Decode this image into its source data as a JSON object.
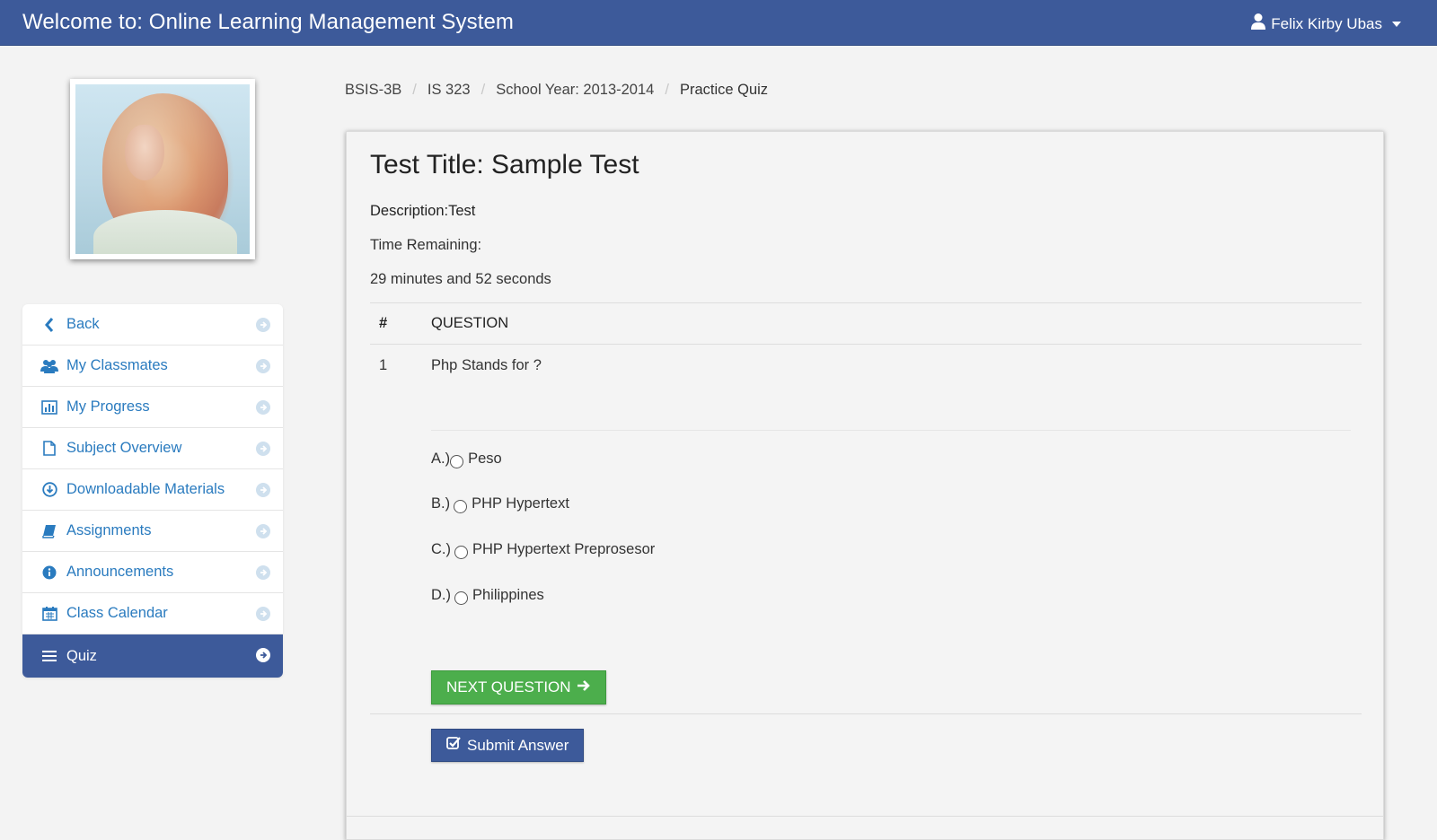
{
  "app": {
    "title": "Welcome to: Online Learning Management System",
    "user_name": "Felix Kirby Ubas",
    "accent_color": "#3d5a9a",
    "success_color": "#4cae4c",
    "link_color": "#2a7bbf"
  },
  "profile": {
    "photo_icon": "profile-photo"
  },
  "sidebar": {
    "items": [
      {
        "label": "Back",
        "icon": "chevron-left-icon",
        "active": false
      },
      {
        "label": "My Classmates",
        "icon": "users-icon",
        "active": false
      },
      {
        "label": "My Progress",
        "icon": "bar-chart-icon",
        "active": false
      },
      {
        "label": "Subject Overview",
        "icon": "file-icon",
        "active": false
      },
      {
        "label": "Downloadable Materials",
        "icon": "download-icon",
        "active": false
      },
      {
        "label": "Assignments",
        "icon": "book-icon",
        "active": false
      },
      {
        "label": "Announcements",
        "icon": "info-icon",
        "active": false
      },
      {
        "label": "Class Calendar",
        "icon": "calendar-icon",
        "active": false
      },
      {
        "label": "Quiz",
        "icon": "list-icon",
        "active": true
      }
    ]
  },
  "breadcrumb": {
    "items": [
      "BSIS-3B",
      "IS 323",
      "School Year: 2013-2014"
    ],
    "current": "Practice Quiz",
    "separator": "/"
  },
  "quiz": {
    "title": "Test Title: Sample Test",
    "description": "Description:Test",
    "time_label": "Time Remaining:",
    "time_value": "29 minutes and 52 seconds",
    "table_headers": {
      "num": "#",
      "question": "QUESTION"
    },
    "question": {
      "num": "1",
      "text": "Php Stands for ?"
    },
    "choices": [
      {
        "letter": "A.)",
        "text": "Peso"
      },
      {
        "letter": "B.)",
        "text": "PHP Hypertext"
      },
      {
        "letter": "C.)",
        "text": "PHP Hypertext Preprosesor"
      },
      {
        "letter": "D.)",
        "text": "Philippines"
      }
    ],
    "next_label": "NEXT QUESTION",
    "submit_label": "Submit Answer"
  }
}
